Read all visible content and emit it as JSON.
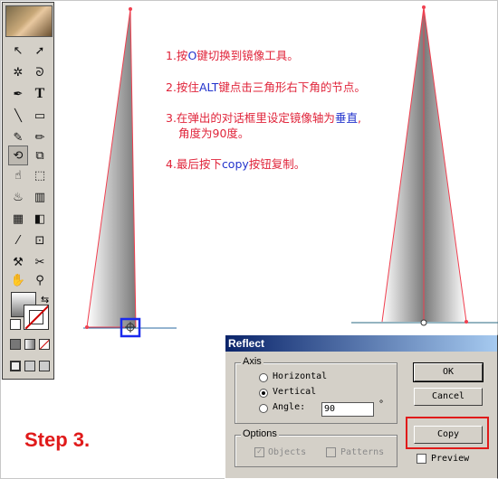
{
  "annotations": [
    {
      "prefix": "1.按",
      "key": "O",
      "suffix": "键切换到镜像工具。"
    },
    {
      "prefix": "2.按住",
      "key": "ALT",
      "suffix": "键点击三角形右下角的节点。"
    },
    {
      "prefix": "3.在弹出的对话框里设定镜像轴为",
      "key": "垂直",
      "suffix": ","
    },
    {
      "prefix": "角度为90度。",
      "key": "",
      "suffix": ""
    },
    {
      "prefix": "4.最后按下",
      "key": "copy",
      "suffix": "按钮复制。"
    }
  ],
  "step_label": "Step 3.",
  "dialog": {
    "title": "Reflect",
    "axis_label": "Axis",
    "horizontal": "Horizontal",
    "vertical": "Vertical",
    "angle_label": "Angle:",
    "angle_value": "90",
    "degree": "°",
    "options_label": "Options",
    "objects": "Objects",
    "patterns": "Patterns",
    "ok": "OK",
    "cancel": "Cancel",
    "copy": "Copy",
    "preview": "Preview"
  },
  "toolbox": {
    "tools": [
      "selection-icon",
      "direct-selection-icon",
      "magic-wand-icon",
      "lasso-icon",
      "pen-icon",
      "type-icon",
      "line-icon",
      "rectangle-icon",
      "paintbrush-icon",
      "pencil-icon",
      "rotate-icon",
      "scale-icon",
      "warp-icon",
      "free-transform-icon",
      "symbol-sprayer-icon",
      "column-graph-icon",
      "mesh-icon",
      "gradient-icon",
      "eyedropper-icon",
      "blend-icon",
      "slice-icon",
      "scissors-icon",
      "hand-icon",
      "zoom-icon"
    ]
  }
}
